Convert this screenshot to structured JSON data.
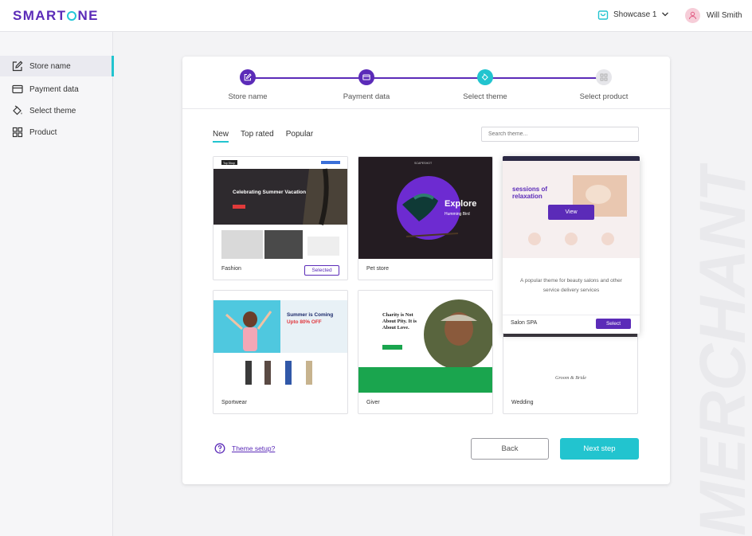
{
  "brand": {
    "logo_left": "SMART",
    "logo_right": "NE"
  },
  "header": {
    "shop_name": "Showcase 1",
    "user_name": "Will Smith"
  },
  "sidebar": {
    "items": [
      {
        "label": "Store name",
        "icon": "edit-icon",
        "active": true
      },
      {
        "label": "Payment data",
        "icon": "credit-card-icon",
        "active": false
      },
      {
        "label": "Select theme",
        "icon": "paint-bucket-icon",
        "active": false
      },
      {
        "label": "Product",
        "icon": "grid-icon",
        "active": false
      }
    ]
  },
  "stepper": {
    "steps": [
      {
        "label": "Store name",
        "state": "done"
      },
      {
        "label": "Payment data",
        "state": "done"
      },
      {
        "label": "Select theme",
        "state": "current"
      },
      {
        "label": "Select product",
        "state": "upcoming"
      }
    ]
  },
  "tabs": [
    "New",
    "Top rated",
    "Popular"
  ],
  "active_tab": "New",
  "search": {
    "placeholder": "Search theme..."
  },
  "themes": [
    {
      "name": "Fashion",
      "action": "Selected",
      "thumb": {
        "nav": "Top Shop",
        "headline": "Celebrating Summer Vacation"
      }
    },
    {
      "name": "Pet store",
      "thumb": {
        "brand": "SCAPESHOT",
        "headline": "Explore",
        "subhead": "Humming Bird"
      }
    },
    {
      "name": "Salon SPA",
      "action": "Select",
      "hover_label": "View",
      "description": "A popular theme for beauty salons and other service delivery services",
      "thumb": {
        "headline_1": "sessions of",
        "headline_2": "relaxation"
      }
    },
    {
      "name": "Sportwear",
      "thumb": {
        "headline_1": "Summer is Coming",
        "headline_2": "Upto 80% OFF"
      }
    },
    {
      "name": "Giver",
      "thumb": {
        "headline_1": "Charity is Not",
        "headline_2": "About Pity. It is",
        "headline_3": "About Love."
      }
    },
    {
      "name": "Wedding",
      "thumb": {
        "script": "Groom & Bride"
      }
    }
  ],
  "footer": {
    "help_link": "Theme setup?",
    "back_label": "Back",
    "next_label": "Next step"
  },
  "watermark": "MERCHANT",
  "colors": {
    "primary": "#5b2bb8",
    "accent": "#22c4cf",
    "background": "#f3f3f5"
  }
}
